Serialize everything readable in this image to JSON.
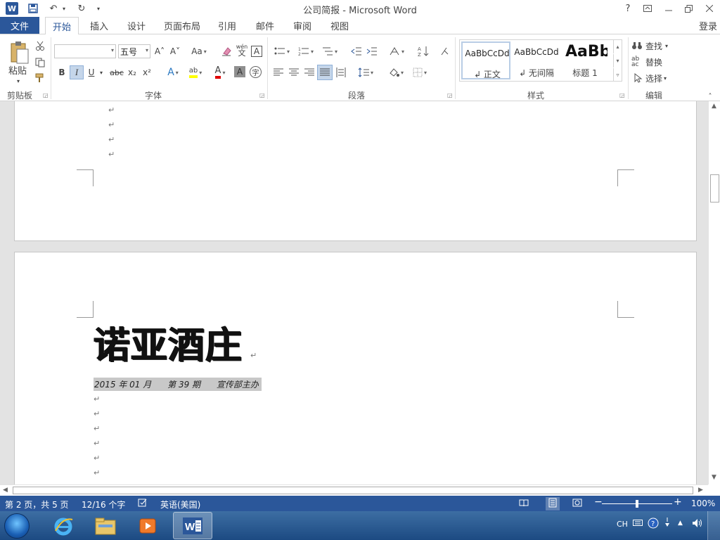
{
  "window": {
    "title": "公司简报 - Microsoft Word",
    "help": "?",
    "login": "登录"
  },
  "qat": {
    "word": "W",
    "save": "💾",
    "undo": "↶",
    "redo": "↻",
    "more": "▾"
  },
  "tabs": {
    "file": "文件",
    "items": [
      "开始",
      "插入",
      "设计",
      "页面布局",
      "引用",
      "邮件",
      "审阅",
      "视图"
    ]
  },
  "ribbon": {
    "clipboard": {
      "label": "剪贴板",
      "paste": "粘贴"
    },
    "font": {
      "label": "字体",
      "name_value": "",
      "size_value": "五号",
      "grow": "A˄",
      "shrink": "A˅",
      "case": "Aa",
      "pinyin_top": "wén",
      "pinyin_bottom": "文",
      "border_char": "A",
      "bold": "B",
      "italic": "I",
      "underline": "U",
      "strike": "abc",
      "subscript": "x₂",
      "superscript": "x²",
      "effects": "A",
      "highlight": "ab",
      "fontcolor": "A",
      "shading": "A",
      "enclose": "字"
    },
    "paragraph": {
      "label": "段落"
    },
    "styles": {
      "label": "样式",
      "items": [
        {
          "sample": "AaBbCcDd",
          "name": "↲ 正文"
        },
        {
          "sample": "AaBbCcDd",
          "name": "↲ 无间隔"
        },
        {
          "sample": "AaBb",
          "name": "标题 1"
        }
      ]
    },
    "editing": {
      "label": "编辑",
      "find": "查找",
      "replace": "替换",
      "select": "选择"
    }
  },
  "document": {
    "title": "诺亚酒庄",
    "issue": "2015 年 01 月      第 39 期      宣传部主办",
    "para_mark": "↵"
  },
  "status": {
    "page": "第 2 页，共 5 页",
    "words": "12/16 个字",
    "language": "英语(美国)",
    "zoom": "100%",
    "zoom_minus": "−",
    "zoom_plus": "+"
  },
  "tray": {
    "lang": "CH"
  }
}
